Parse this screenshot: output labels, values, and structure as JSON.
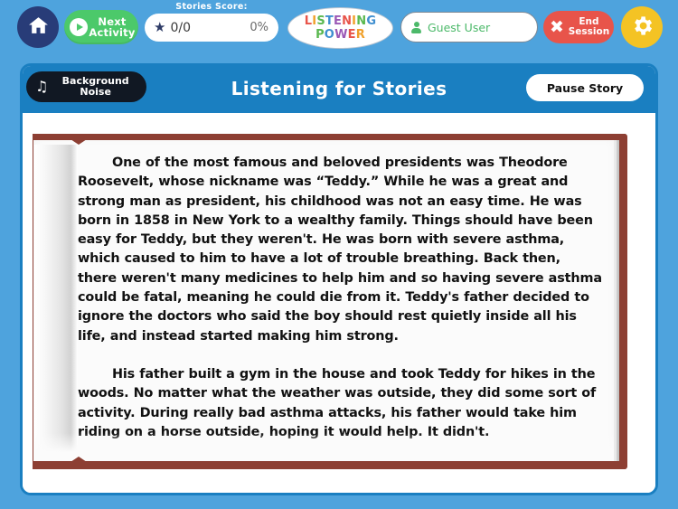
{
  "colors": {
    "app_background": "#4ea3dd",
    "panel_border": "#1a7fc1",
    "header_blue": "#1a7fc1",
    "home_navy": "#283c78",
    "next_green": "#4cc96a",
    "end_red": "#e8544a",
    "gear_yellow": "#f4c324",
    "book_brown": "#8d3f33",
    "user_green": "#4cb96a"
  },
  "topbar": {
    "home_icon": "home-icon",
    "next_activity": {
      "icon": "play-icon",
      "line1": "Next",
      "line2": "Activity"
    },
    "score": {
      "title": "Stories Score:",
      "icon": "star-icon",
      "fraction": "0/0",
      "percent": "0%"
    },
    "logo": {
      "line1": "LISTENING",
      "line2": "POWER",
      "line1_letters": [
        {
          "ch": "L",
          "color": "#e8544a"
        },
        {
          "ch": "I",
          "color": "#f0a02a"
        },
        {
          "ch": "S",
          "color": "#5ab84f"
        },
        {
          "ch": "T",
          "color": "#3f8fd0"
        },
        {
          "ch": "E",
          "color": "#9b59b6"
        },
        {
          "ch": "N",
          "color": "#e8544a"
        },
        {
          "ch": "I",
          "color": "#f0a02a"
        },
        {
          "ch": "N",
          "color": "#5ab84f"
        },
        {
          "ch": "G",
          "color": "#3f8fd0"
        }
      ],
      "line2_letters": [
        {
          "ch": "P",
          "color": "#5ab84f"
        },
        {
          "ch": "O",
          "color": "#3f8fd0"
        },
        {
          "ch": "W",
          "color": "#9b59b6"
        },
        {
          "ch": "E",
          "color": "#e8544a"
        },
        {
          "ch": "R",
          "color": "#f0a02a"
        }
      ]
    },
    "user": {
      "icon": "user-icon",
      "name": "Guest User"
    },
    "end_session": {
      "icon": "close-x-icon",
      "line1": "End",
      "line2": "Session"
    },
    "settings_icon": "gear-icon"
  },
  "panel": {
    "background_noise": {
      "icon": "music-note-icon",
      "line1": "Background",
      "line2": "Noise"
    },
    "title": "Listening for Stories",
    "pause_story_label": "Pause Story"
  },
  "story": {
    "paragraph1": "One of the most famous and beloved presidents was Theodore Roosevelt, whose nickname was “Teddy.” While he was a great and strong man as president, his childhood was not an easy time. He was born in 1858 in New York to a wealthy family. Things should have been easy for Teddy, but they weren't. He was born with severe asthma, which caused to him to have a lot of trouble breathing. Back then, there weren't many medicines to help him and so having severe asthma could be fatal, meaning he could die from it. Teddy's father decided to ignore the doctors who said the boy should rest quietly inside all his life, and instead started making him strong.",
    "paragraph2": "His father built a gym in the house and took Teddy for hikes in the woods. No matter what the weather was outside, they did some sort of activity. During really bad asthma attacks, his father would take him riding on a horse outside, hoping it would help. It didn't."
  }
}
